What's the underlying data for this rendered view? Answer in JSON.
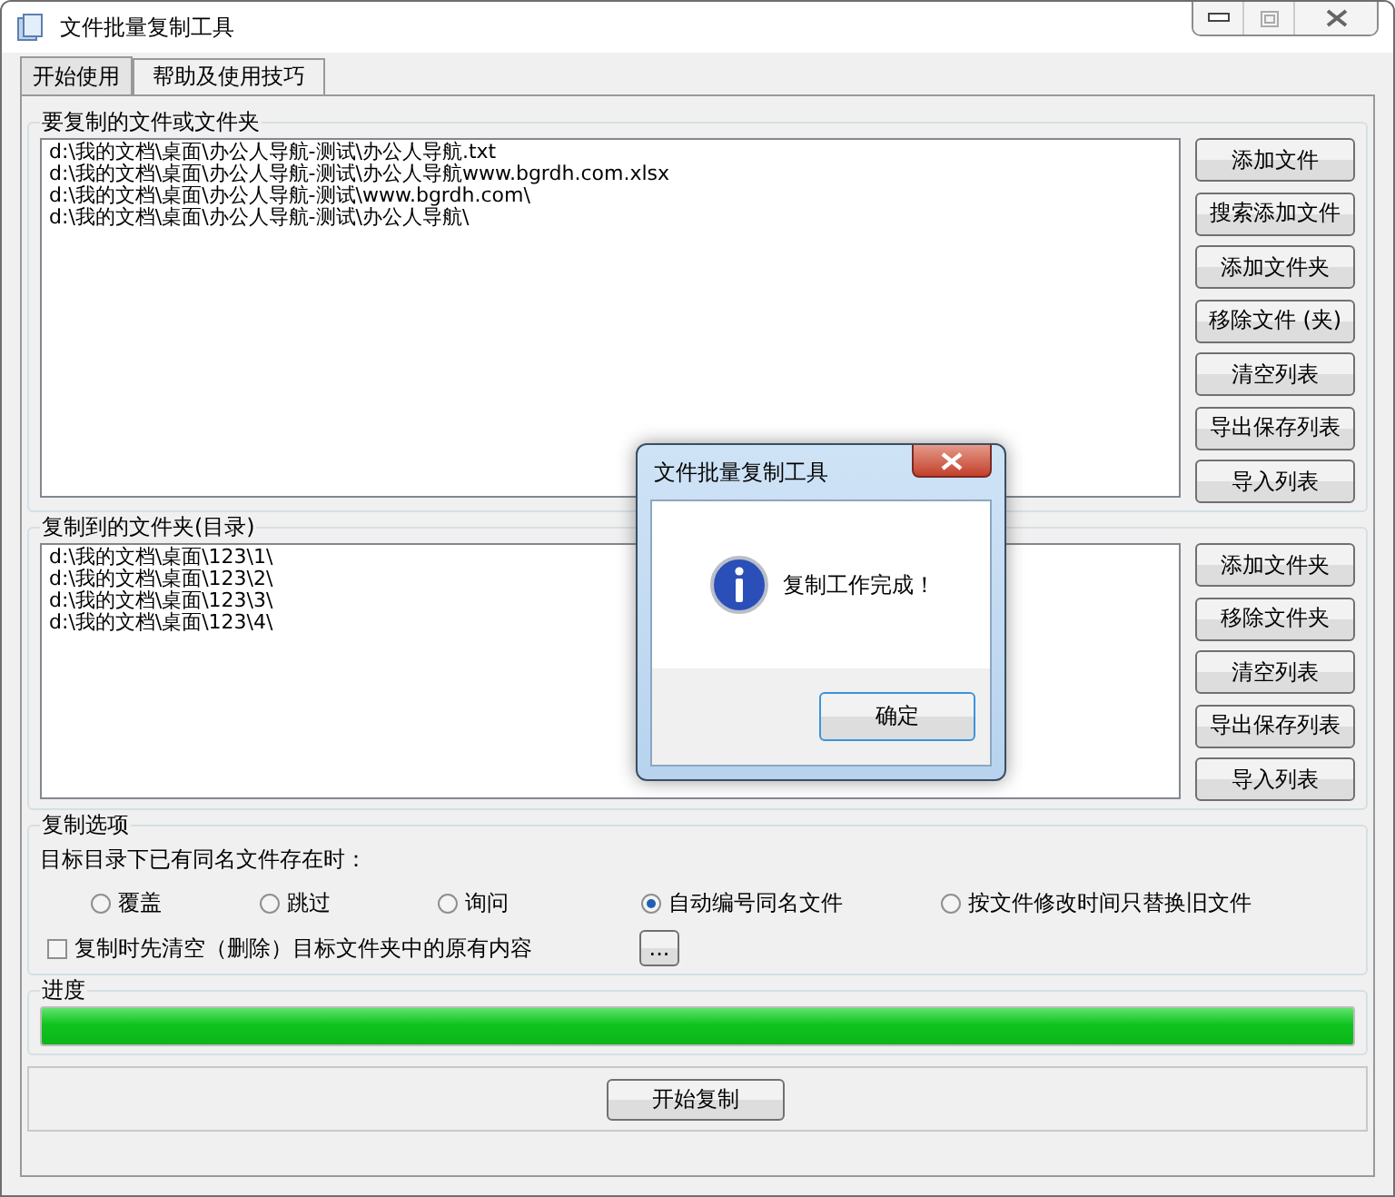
{
  "window": {
    "title": "文件批量复制工具"
  },
  "tabs": [
    {
      "label": "开始使用",
      "selected": true
    },
    {
      "label": "帮助及使用技巧",
      "selected": false
    }
  ],
  "source_group": {
    "label": "要复制的文件或文件夹",
    "items": [
      "d:\\我的文档\\桌面\\办公人导航-测试\\办公人导航.txt",
      "d:\\我的文档\\桌面\\办公人导航-测试\\办公人导航www.bgrdh.com.xlsx",
      "d:\\我的文档\\桌面\\办公人导航-测试\\www.bgrdh.com\\",
      "d:\\我的文档\\桌面\\办公人导航-测试\\办公人导航\\"
    ],
    "buttons": [
      "添加文件",
      "搜索添加文件",
      "添加文件夹",
      "移除文件 (夹)",
      "清空列表",
      "导出保存列表",
      "导入列表"
    ]
  },
  "target_group": {
    "label": "复制到的文件夹(目录)",
    "items": [
      "d:\\我的文档\\桌面\\123\\1\\",
      "d:\\我的文档\\桌面\\123\\2\\",
      "d:\\我的文档\\桌面\\123\\3\\",
      "d:\\我的文档\\桌面\\123\\4\\"
    ],
    "buttons": [
      "添加文件夹",
      "移除文件夹",
      "清空列表",
      "导出保存列表",
      "导入列表"
    ]
  },
  "options_group": {
    "label": "复制选项",
    "prompt": "目标目录下已有同名文件存在时：",
    "radios": [
      {
        "label": "覆盖",
        "selected": false
      },
      {
        "label": "跳过",
        "selected": false
      },
      {
        "label": "询问",
        "selected": false
      },
      {
        "label": "自动编号同名文件",
        "selected": true
      },
      {
        "label": "按文件修改时间只替换旧文件",
        "selected": false
      }
    ],
    "checkbox": {
      "label": "复制时先清空（删除）目标文件夹中的原有内容",
      "checked": false
    },
    "more_button": "..."
  },
  "progress_group": {
    "label": "进度",
    "level": 1.0
  },
  "start_button": "开始复制",
  "dialog": {
    "title": "文件批量复制工具",
    "message": "复制工作完成！",
    "ok_button": "确定"
  }
}
